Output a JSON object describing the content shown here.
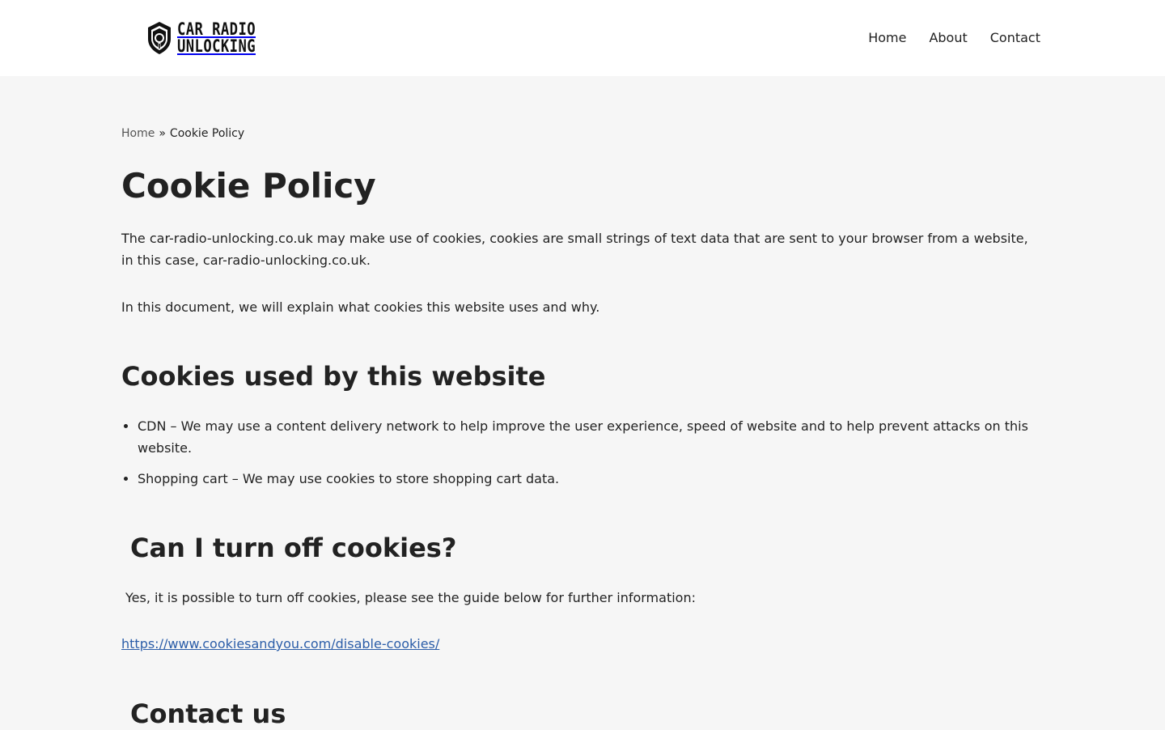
{
  "header": {
    "logo": {
      "line1": "CAR RADIO",
      "line2": "UNLOCKING",
      "icon": "car-radio-shield-icon"
    },
    "nav": [
      {
        "label": "Home"
      },
      {
        "label": "About"
      },
      {
        "label": "Contact"
      }
    ]
  },
  "breadcrumb": {
    "home": "Home",
    "separator": "»",
    "current": "Cookie Policy"
  },
  "page": {
    "title": "Cookie Policy",
    "intro": "The car-radio-unlocking.co.uk may make use of cookies, cookies are small strings of text data that are sent to your browser from a website, in this case, car-radio-unlocking.co.uk.",
    "intro2": "In this document, we will explain what cookies this website uses and why.",
    "section1": {
      "heading": "Cookies used by this website",
      "items": [
        "CDN – We may use a content delivery network to help improve the user experience, speed of website and to help prevent attacks on this website.",
        "Shopping cart – We may use cookies to store shopping cart data."
      ]
    },
    "section2": {
      "heading": "Can I turn off cookies?",
      "text": "Yes, it is possible to turn off cookies, please see the guide below for further information:",
      "link": "https://www.cookiesandyou.com/disable-cookies/"
    },
    "section3": {
      "heading": "Contact us"
    }
  },
  "colors": {
    "background": "#f6f6f6",
    "header": "#ffffff",
    "text": "#222222",
    "link": "#2b5da8"
  }
}
